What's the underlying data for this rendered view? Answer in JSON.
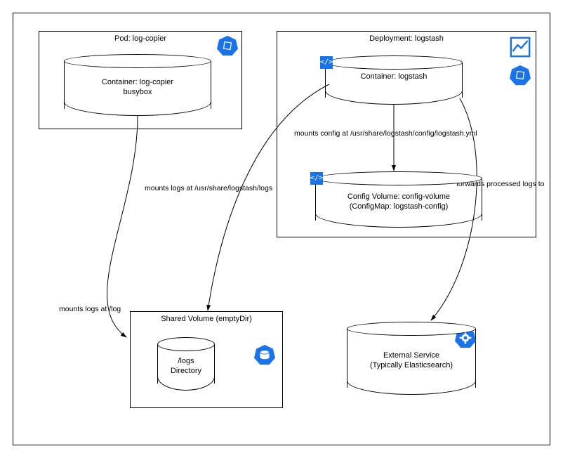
{
  "pod": {
    "title": "Pod: log-copier",
    "container_line1": "Container: log-copier",
    "container_line2": "busybox"
  },
  "deployment": {
    "title": "Deployment: logstash",
    "container_label": "Container: logstash",
    "config_line1": "Config Volume: config-volume",
    "config_line2": "(ConfigMap: logstash-config)"
  },
  "shared_volume": {
    "title": "Shared Volume (emptyDir)",
    "dir_line1": "/logs",
    "dir_line2": "Directory"
  },
  "external": {
    "line1": "External Service",
    "line2": "(Typically Elasticsearch)"
  },
  "edges": {
    "mounts_log": "mounts logs at /log",
    "mounts_logs_logstash": "mounts logs at /usr/share/logstash/logs",
    "mounts_config": "mounts config at /usr/share/logstash/config/logstash.yml",
    "forwards": "forwards processed logs to"
  }
}
